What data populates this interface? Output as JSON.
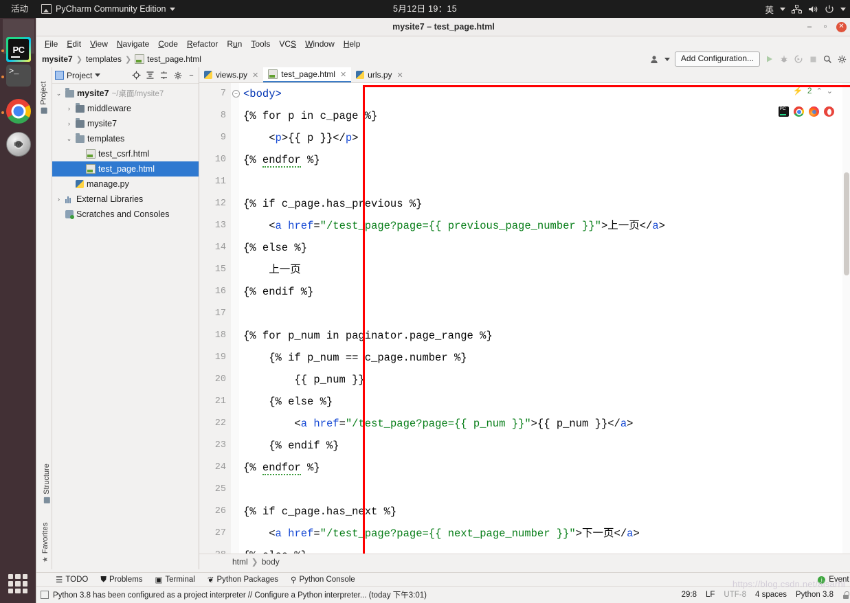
{
  "gnome": {
    "activities": "活动",
    "app_name": "PyCharm Community Edition",
    "clock": "5月12日 19：15",
    "input_method": "英"
  },
  "dock": {
    "items": [
      {
        "name": "pycharm",
        "label": "PC"
      },
      {
        "name": "terminal",
        "label": ">_"
      },
      {
        "name": "chrome",
        "label": ""
      },
      {
        "name": "dvd",
        "label": "DVD"
      }
    ]
  },
  "window": {
    "title": "mysite7 – test_page.html"
  },
  "menubar": {
    "items": [
      "File",
      "Edit",
      "View",
      "Navigate",
      "Code",
      "Refactor",
      "Run",
      "Tools",
      "VCS",
      "Window",
      "Help"
    ]
  },
  "navbar": {
    "crumbs": [
      "mysite7",
      "templates",
      "test_page.html"
    ],
    "add_configuration": "Add Configuration..."
  },
  "project_panel": {
    "title": "Project",
    "tree": [
      {
        "indent": 0,
        "arrow": "v",
        "icon": "folder",
        "label": "mysite7",
        "hint": "~/桌面/mysite7",
        "bold": true,
        "selected": false
      },
      {
        "indent": 1,
        "arrow": ">",
        "icon": "folder-dark",
        "label": "middleware",
        "hint": "",
        "bold": false,
        "selected": false
      },
      {
        "indent": 1,
        "arrow": ">",
        "icon": "folder-dark",
        "label": "mysite7",
        "hint": "",
        "bold": false,
        "selected": false
      },
      {
        "indent": 1,
        "arrow": "v",
        "icon": "folder",
        "label": "templates",
        "hint": "",
        "bold": false,
        "selected": false
      },
      {
        "indent": 2,
        "arrow": "",
        "icon": "html",
        "label": "test_csrf.html",
        "hint": "",
        "bold": false,
        "selected": false
      },
      {
        "indent": 2,
        "arrow": "",
        "icon": "html",
        "label": "test_page.html",
        "hint": "",
        "bold": false,
        "selected": true
      },
      {
        "indent": 1,
        "arrow": "",
        "icon": "py",
        "label": "manage.py",
        "hint": "",
        "bold": false,
        "selected": false
      },
      {
        "indent": 0,
        "arrow": ">",
        "icon": "lib",
        "label": "External Libraries",
        "hint": "",
        "bold": false,
        "selected": false
      },
      {
        "indent": 0,
        "arrow": "",
        "icon": "scratch",
        "label": "Scratches and Consoles",
        "hint": "",
        "bold": false,
        "selected": false
      }
    ]
  },
  "side_strips": {
    "project": "Project",
    "structure": "Structure",
    "favorites": "Favorites"
  },
  "tabs": [
    {
      "label": "views.py",
      "icon": "py",
      "active": false
    },
    {
      "label": "test_page.html",
      "icon": "html",
      "active": true
    },
    {
      "label": "urls.py",
      "icon": "py",
      "active": false
    }
  ],
  "editor": {
    "first_line": 7,
    "lines": [
      {
        "n": 7,
        "html": "<span class=\"tag\">&lt;body&gt;</span>"
      },
      {
        "n": 8,
        "html": "{% for p in c_page %}"
      },
      {
        "n": 9,
        "html": "    &lt;<span class=\"attr\">p</span>&gt;{{ p }}&lt;/<span class=\"attr\">p</span>&gt;"
      },
      {
        "n": 10,
        "html": "{% <span class=\"sqg\">endfor</span> %}"
      },
      {
        "n": 11,
        "html": ""
      },
      {
        "n": 12,
        "html": "{% if c_page.has_previous %}"
      },
      {
        "n": 13,
        "html": "    &lt;<span class=\"attr\">a</span> <span class=\"attr\">href</span>=<span class=\"str\">\"/test_page?page={{ previous_page_number }}\"</span>&gt;上一页&lt;/<span class=\"attr\">a</span>&gt;"
      },
      {
        "n": 14,
        "html": "{% else %}"
      },
      {
        "n": 15,
        "html": "    上一页"
      },
      {
        "n": 16,
        "html": "{% endif %}"
      },
      {
        "n": 17,
        "html": ""
      },
      {
        "n": 18,
        "html": "{% for p_num in paginator.page_range %}"
      },
      {
        "n": 19,
        "html": "    {% if p_num == c_page.number %}"
      },
      {
        "n": 20,
        "html": "        {{ p_num }}"
      },
      {
        "n": 21,
        "html": "    {% else %}"
      },
      {
        "n": 22,
        "html": "        &lt;<span class=\"attr\">a</span> <span class=\"attr\">href</span>=<span class=\"str\">\"/test_page?page={{ p_num }}\"</span>&gt;{{ p_num }}&lt;/<span class=\"attr\">a</span>&gt;"
      },
      {
        "n": 23,
        "html": "    {% endif %}"
      },
      {
        "n": 24,
        "html": "{% <span class=\"sqg\">endfor</span> %}"
      },
      {
        "n": 25,
        "html": ""
      },
      {
        "n": 26,
        "html": "{% if c_page.has_next %}"
      },
      {
        "n": 27,
        "html": "    &lt;<span class=\"attr\">a</span> <span class=\"attr\">href</span>=<span class=\"str\">\"/test_page?page={{ next_page_number }}\"</span>&gt;下一页&lt;/<span class=\"attr\">a</span>&gt;"
      },
      {
        "n": 28,
        "html": "{% else %}"
      }
    ],
    "inspection_count": "2",
    "breadcrumbs": [
      "html",
      "body"
    ]
  },
  "bottom_tools": {
    "items": [
      "TODO",
      "Problems",
      "Terminal",
      "Python Packages",
      "Python Console"
    ],
    "event_log": "Event Log"
  },
  "status": {
    "message": "Python 3.8 has been configured as a project interpreter // Configure a Python interpreter... (today 下午3:01)",
    "caret": "29:8",
    "line_sep": "LF",
    "encoding": "UTF-8",
    "indent": "4 spaces",
    "interpreter": "Python 3.8"
  },
  "watermark": "https://blog.csdn.net/aisarhl"
}
